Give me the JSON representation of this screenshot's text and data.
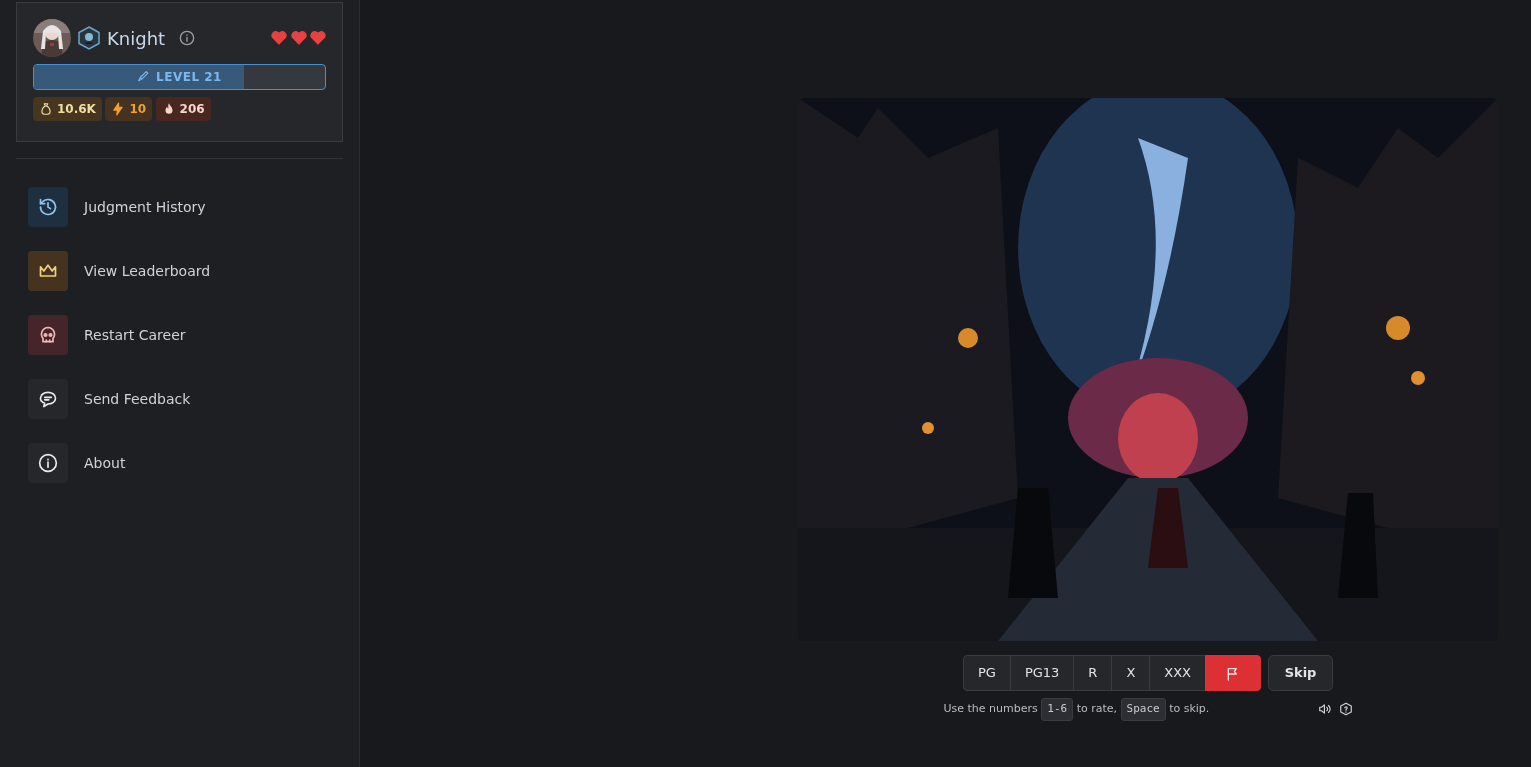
{
  "profile": {
    "name": "Knight",
    "hearts": [
      {
        "filled": true
      },
      {
        "filled": true
      },
      {
        "filled": true
      }
    ],
    "level": {
      "label": "LEVEL 21",
      "level": 0.72
    },
    "stats": [
      {
        "kind": "gold",
        "value": "10.6K",
        "color": "#463620"
      },
      {
        "kind": "energy",
        "value": "10",
        "color": "#453220"
      },
      {
        "kind": "streak",
        "value": "206",
        "color": "#47271f"
      }
    ]
  },
  "menu": [
    {
      "kind": "history",
      "label": "Judgment History",
      "color": "#1e2f40"
    },
    {
      "kind": "leaderboard",
      "label": "View Leaderboard",
      "color": "#45331f"
    },
    {
      "kind": "restart",
      "label": "Restart Career",
      "color": "#45242a"
    },
    {
      "kind": "feedback",
      "label": "Send Feedback",
      "color": "#26272b"
    },
    {
      "kind": "about",
      "label": "About",
      "color": "#26272b"
    }
  ],
  "ratings": [
    {
      "kind": "text",
      "label": "PG"
    },
    {
      "kind": "text",
      "label": "PG13"
    },
    {
      "kind": "text",
      "label": "R"
    },
    {
      "kind": "text",
      "label": "X"
    },
    {
      "kind": "text",
      "label": "XXX"
    },
    {
      "kind": "flag"
    }
  ],
  "skip": "Skip",
  "hint": [
    {
      "kind": "text",
      "text": "Use the numbers"
    },
    {
      "kind": "key",
      "text": "1-6"
    },
    {
      "kind": "text",
      "text": "to rate,"
    },
    {
      "kind": "key",
      "text": "Space"
    },
    {
      "kind": "text",
      "text": "to skip."
    }
  ]
}
